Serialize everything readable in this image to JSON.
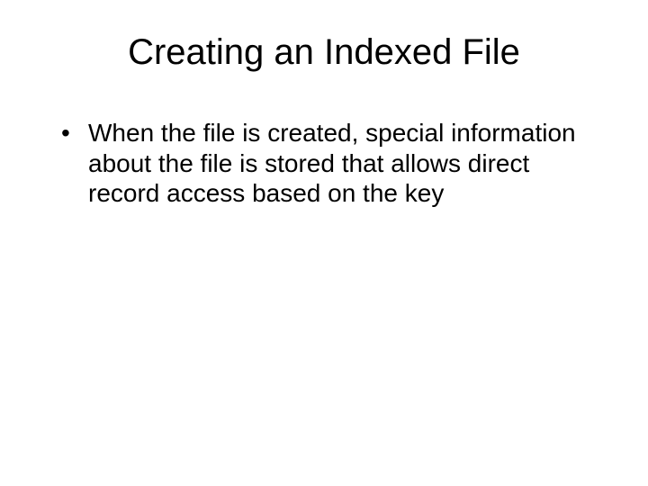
{
  "slide": {
    "title": "Creating an Indexed File",
    "bullets": [
      "When the file is created, special information about the file is stored that allows direct record access based on the key"
    ]
  }
}
